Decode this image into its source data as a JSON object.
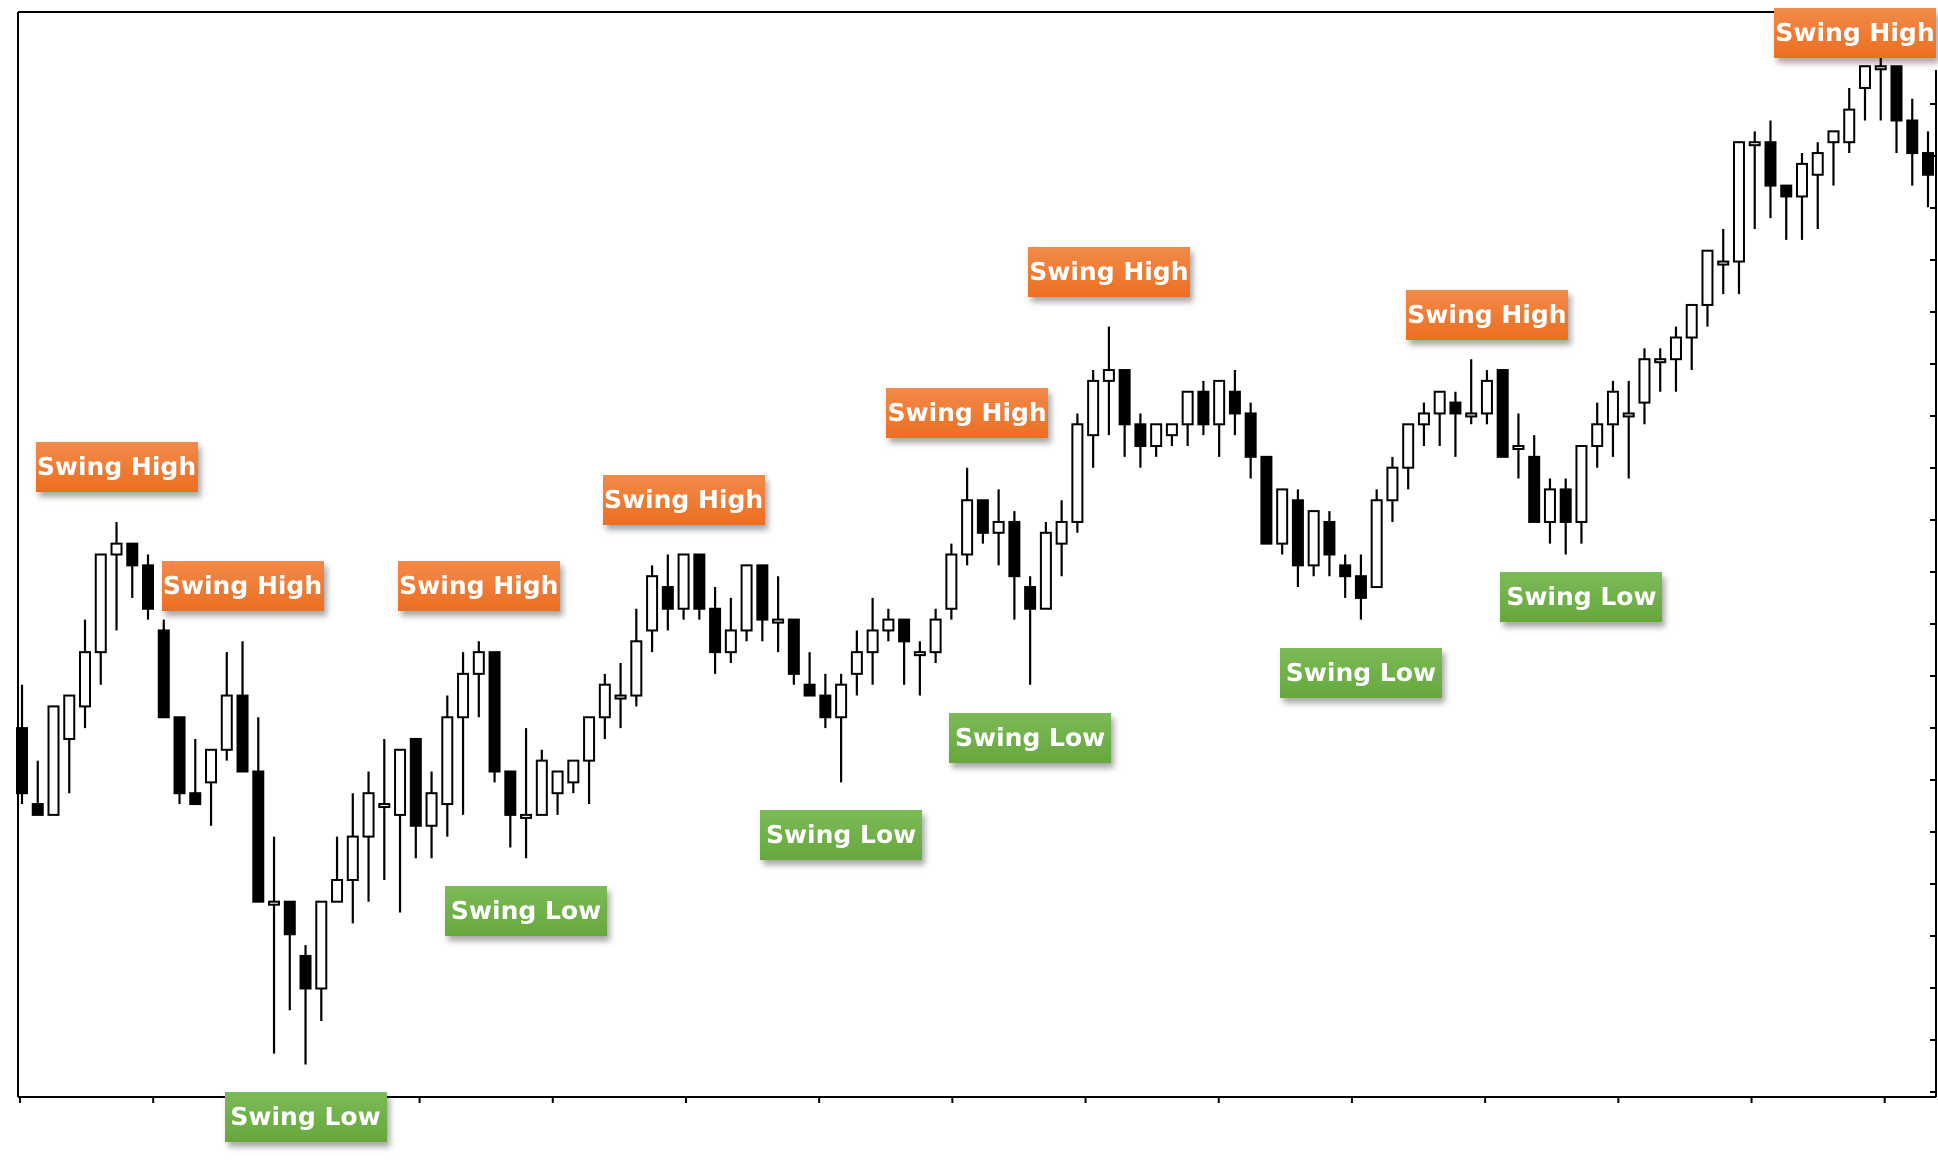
{
  "chart_data": {
    "type": "candlestick",
    "title": "",
    "xlabel": "",
    "ylabel": "",
    "price_units": "relative (0 = bottom of plot, 100 = top of plot; no axis values shown)",
    "ylim": [
      0,
      100
    ],
    "grid": false,
    "legend": "none",
    "colors": {
      "bullish_body": "#ffffff",
      "bearish_body": "#000000",
      "wick": "#000000",
      "swing_high_label": "#ee7627",
      "swing_low_label": "#6fb043",
      "label_text": "#ffffff"
    },
    "candles": [
      {
        "o": 34,
        "h": 38,
        "l": 27,
        "c": 28
      },
      {
        "o": 27,
        "h": 31,
        "l": 26,
        "c": 26
      },
      {
        "o": 26,
        "h": 36,
        "l": 27,
        "c": 36
      },
      {
        "o": 33,
        "h": 37,
        "l": 28,
        "c": 37
      },
      {
        "o": 36,
        "h": 44,
        "l": 34,
        "c": 41
      },
      {
        "o": 41,
        "h": 50,
        "l": 38,
        "c": 50
      },
      {
        "o": 50,
        "h": 53,
        "l": 43,
        "c": 51
      },
      {
        "o": 51,
        "h": 50,
        "l": 46,
        "c": 49
      },
      {
        "o": 49,
        "h": 50,
        "l": 44,
        "c": 45
      },
      {
        "o": 43,
        "h": 44,
        "l": 35,
        "c": 35
      },
      {
        "o": 35,
        "h": 35,
        "l": 27,
        "c": 28
      },
      {
        "o": 28,
        "h": 33,
        "l": 27,
        "c": 27
      },
      {
        "o": 29,
        "h": 31,
        "l": 25,
        "c": 32
      },
      {
        "o": 32,
        "h": 41,
        "l": 31,
        "c": 37
      },
      {
        "o": 37,
        "h": 42,
        "l": 30,
        "c": 30
      },
      {
        "o": 30,
        "h": 35,
        "l": 18,
        "c": 18
      },
      {
        "o": 18,
        "h": 24,
        "l": 4,
        "c": 18
      },
      {
        "o": 18,
        "h": 18,
        "l": 8,
        "c": 15
      },
      {
        "o": 13,
        "h": 14,
        "l": 3,
        "c": 10
      },
      {
        "o": 10,
        "h": 18,
        "l": 7,
        "c": 18
      },
      {
        "o": 18,
        "h": 24,
        "l": 18,
        "c": 20
      },
      {
        "o": 20,
        "h": 28,
        "l": 16,
        "c": 24
      },
      {
        "o": 24,
        "h": 30,
        "l": 18,
        "c": 28
      },
      {
        "o": 27,
        "h": 33,
        "l": 20,
        "c": 27
      },
      {
        "o": 26,
        "h": 31,
        "l": 17,
        "c": 32
      },
      {
        "o": 33,
        "h": 31,
        "l": 22,
        "c": 25
      },
      {
        "o": 25,
        "h": 30,
        "l": 22,
        "c": 28
      },
      {
        "o": 27,
        "h": 37,
        "l": 24,
        "c": 35
      },
      {
        "o": 35,
        "h": 41,
        "l": 26,
        "c": 39
      },
      {
        "o": 39,
        "h": 42,
        "l": 35,
        "c": 41
      },
      {
        "o": 41,
        "h": 40,
        "l": 29,
        "c": 30
      },
      {
        "o": 30,
        "h": 30,
        "l": 23,
        "c": 26
      },
      {
        "o": 26,
        "h": 34,
        "l": 22,
        "c": 26
      },
      {
        "o": 26,
        "h": 32,
        "l": 26,
        "c": 31
      },
      {
        "o": 28,
        "h": 30,
        "l": 26,
        "c": 30
      },
      {
        "o": 29,
        "h": 31,
        "l": 28,
        "c": 31
      },
      {
        "o": 31,
        "h": 34,
        "l": 27,
        "c": 35
      },
      {
        "o": 35,
        "h": 39,
        "l": 33,
        "c": 38
      },
      {
        "o": 37,
        "h": 40,
        "l": 34,
        "c": 37
      },
      {
        "o": 37,
        "h": 45,
        "l": 36,
        "c": 42
      },
      {
        "o": 43,
        "h": 49,
        "l": 41,
        "c": 48
      },
      {
        "o": 47,
        "h": 50,
        "l": 43,
        "c": 45
      },
      {
        "o": 45,
        "h": 50,
        "l": 44,
        "c": 50
      },
      {
        "o": 50,
        "h": 49,
        "l": 44,
        "c": 45
      },
      {
        "o": 45,
        "h": 47,
        "l": 39,
        "c": 41
      },
      {
        "o": 41,
        "h": 46,
        "l": 40,
        "c": 43
      },
      {
        "o": 43,
        "h": 49,
        "l": 42,
        "c": 49
      },
      {
        "o": 49,
        "h": 49,
        "l": 42,
        "c": 44
      },
      {
        "o": 44,
        "h": 48,
        "l": 41,
        "c": 44
      },
      {
        "o": 44,
        "h": 44,
        "l": 38,
        "c": 39
      },
      {
        "o": 38,
        "h": 41,
        "l": 37,
        "c": 37
      },
      {
        "o": 37,
        "h": 39,
        "l": 34,
        "c": 35
      },
      {
        "o": 35,
        "h": 39,
        "l": 29,
        "c": 38
      },
      {
        "o": 39,
        "h": 43,
        "l": 37,
        "c": 41
      },
      {
        "o": 41,
        "h": 46,
        "l": 38,
        "c": 43
      },
      {
        "o": 43,
        "h": 45,
        "l": 42,
        "c": 44
      },
      {
        "o": 44,
        "h": 44,
        "l": 38,
        "c": 42
      },
      {
        "o": 41,
        "h": 42,
        "l": 37,
        "c": 41
      },
      {
        "o": 41,
        "h": 45,
        "l": 40,
        "c": 44
      },
      {
        "o": 45,
        "h": 51,
        "l": 44,
        "c": 50
      },
      {
        "o": 50,
        "h": 58,
        "l": 49,
        "c": 55
      },
      {
        "o": 55,
        "h": 55,
        "l": 51,
        "c": 52
      },
      {
        "o": 52,
        "h": 56,
        "l": 49,
        "c": 53
      },
      {
        "o": 53,
        "h": 54,
        "l": 44,
        "c": 48
      },
      {
        "o": 47,
        "h": 48,
        "l": 38,
        "c": 45
      },
      {
        "o": 45,
        "h": 53,
        "l": 45,
        "c": 52
      },
      {
        "o": 51,
        "h": 55,
        "l": 48,
        "c": 53
      },
      {
        "o": 53,
        "h": 63,
        "l": 52,
        "c": 62
      },
      {
        "o": 61,
        "h": 67,
        "l": 58,
        "c": 66
      },
      {
        "o": 66,
        "h": 71,
        "l": 61,
        "c": 67
      },
      {
        "o": 67,
        "h": 67,
        "l": 59,
        "c": 62
      },
      {
        "o": 62,
        "h": 63,
        "l": 58,
        "c": 60
      },
      {
        "o": 60,
        "h": 62,
        "l": 59,
        "c": 62
      },
      {
        "o": 61,
        "h": 62,
        "l": 60,
        "c": 62
      },
      {
        "o": 62,
        "h": 65,
        "l": 60,
        "c": 65
      },
      {
        "o": 65,
        "h": 66,
        "l": 61,
        "c": 62
      },
      {
        "o": 62,
        "h": 66,
        "l": 59,
        "c": 66
      },
      {
        "o": 65,
        "h": 67,
        "l": 61,
        "c": 63
      },
      {
        "o": 63,
        "h": 64,
        "l": 57,
        "c": 59
      },
      {
        "o": 59,
        "h": 59,
        "l": 51,
        "c": 51
      },
      {
        "o": 51,
        "h": 55,
        "l": 50,
        "c": 56
      },
      {
        "o": 55,
        "h": 56,
        "l": 47,
        "c": 49
      },
      {
        "o": 49,
        "h": 54,
        "l": 48,
        "c": 54
      },
      {
        "o": 53,
        "h": 54,
        "l": 48,
        "c": 50
      },
      {
        "o": 49,
        "h": 50,
        "l": 46,
        "c": 48
      },
      {
        "o": 48,
        "h": 50,
        "l": 44,
        "c": 46
      },
      {
        "o": 47,
        "h": 56,
        "l": 47,
        "c": 55
      },
      {
        "o": 55,
        "h": 59,
        "l": 53,
        "c": 58
      },
      {
        "o": 58,
        "h": 62,
        "l": 56,
        "c": 62
      },
      {
        "o": 62,
        "h": 64,
        "l": 60,
        "c": 63
      },
      {
        "o": 63,
        "h": 65,
        "l": 60,
        "c": 65
      },
      {
        "o": 64,
        "h": 65,
        "l": 59,
        "c": 63
      },
      {
        "o": 63,
        "h": 68,
        "l": 62,
        "c": 63
      },
      {
        "o": 63,
        "h": 67,
        "l": 62,
        "c": 66
      },
      {
        "o": 67,
        "h": 67,
        "l": 60,
        "c": 59
      },
      {
        "o": 60,
        "h": 63,
        "l": 57,
        "c": 60
      },
      {
        "o": 59,
        "h": 61,
        "l": 53,
        "c": 53
      },
      {
        "o": 53,
        "h": 57,
        "l": 51,
        "c": 56
      },
      {
        "o": 56,
        "h": 57,
        "l": 50,
        "c": 53
      },
      {
        "o": 53,
        "h": 59,
        "l": 51,
        "c": 60
      },
      {
        "o": 60,
        "h": 64,
        "l": 58,
        "c": 62
      },
      {
        "o": 62,
        "h": 66,
        "l": 59,
        "c": 65
      },
      {
        "o": 63,
        "h": 66,
        "l": 57,
        "c": 63
      },
      {
        "o": 64,
        "h": 69,
        "l": 62,
        "c": 68
      },
      {
        "o": 68,
        "h": 69,
        "l": 65,
        "c": 68
      },
      {
        "o": 68,
        "h": 71,
        "l": 65,
        "c": 70
      },
      {
        "o": 70,
        "h": 73,
        "l": 67,
        "c": 73
      },
      {
        "o": 73,
        "h": 77,
        "l": 71,
        "c": 78
      },
      {
        "o": 77,
        "h": 80,
        "l": 74,
        "c": 77
      },
      {
        "o": 77,
        "h": 88,
        "l": 74,
        "c": 88
      },
      {
        "o": 88,
        "h": 89,
        "l": 80,
        "c": 88
      },
      {
        "o": 88,
        "h": 90,
        "l": 81,
        "c": 84
      },
      {
        "o": 84,
        "h": 84,
        "l": 79,
        "c": 83
      },
      {
        "o": 83,
        "h": 87,
        "l": 79,
        "c": 86
      },
      {
        "o": 85,
        "h": 88,
        "l": 80,
        "c": 87
      },
      {
        "o": 88,
        "h": 89,
        "l": 84,
        "c": 89
      },
      {
        "o": 88,
        "h": 93,
        "l": 87,
        "c": 91
      },
      {
        "o": 93,
        "h": 95,
        "l": 90,
        "c": 95
      },
      {
        "o": 95,
        "h": 96,
        "l": 90,
        "c": 95
      },
      {
        "o": 95,
        "h": 94,
        "l": 87,
        "c": 90
      },
      {
        "o": 90,
        "h": 92,
        "l": 84,
        "c": 87
      },
      {
        "o": 87,
        "h": 89,
        "l": 82,
        "c": 85
      }
    ],
    "annotations": [
      {
        "text": "Swing High",
        "kind": "high",
        "at_candle": 6
      },
      {
        "text": "Swing High",
        "kind": "high",
        "at_candle": 14
      },
      {
        "text": "Swing Low",
        "kind": "low",
        "at_candle": 18
      },
      {
        "text": "Swing High",
        "kind": "high",
        "at_candle": 29
      },
      {
        "text": "Swing Low",
        "kind": "low",
        "at_candle": 32
      },
      {
        "text": "Swing High",
        "kind": "high",
        "at_candle": 42
      },
      {
        "text": "Swing Low",
        "kind": "low",
        "at_candle": 52
      },
      {
        "text": "Swing High",
        "kind": "high",
        "at_candle": 60
      },
      {
        "text": "Swing Low",
        "kind": "low",
        "at_candle": 64
      },
      {
        "text": "Swing High",
        "kind": "high",
        "at_candle": 69
      },
      {
        "text": "Swing Low",
        "kind": "low",
        "at_candle": 85
      },
      {
        "text": "Swing High",
        "kind": "high",
        "at_candle": 93
      },
      {
        "text": "Swing Low",
        "kind": "low",
        "at_candle": 99
      },
      {
        "text": "Swing High",
        "kind": "high",
        "at_candle": 119
      }
    ],
    "x_tick_count": 15,
    "y_tick_count": 20
  }
}
